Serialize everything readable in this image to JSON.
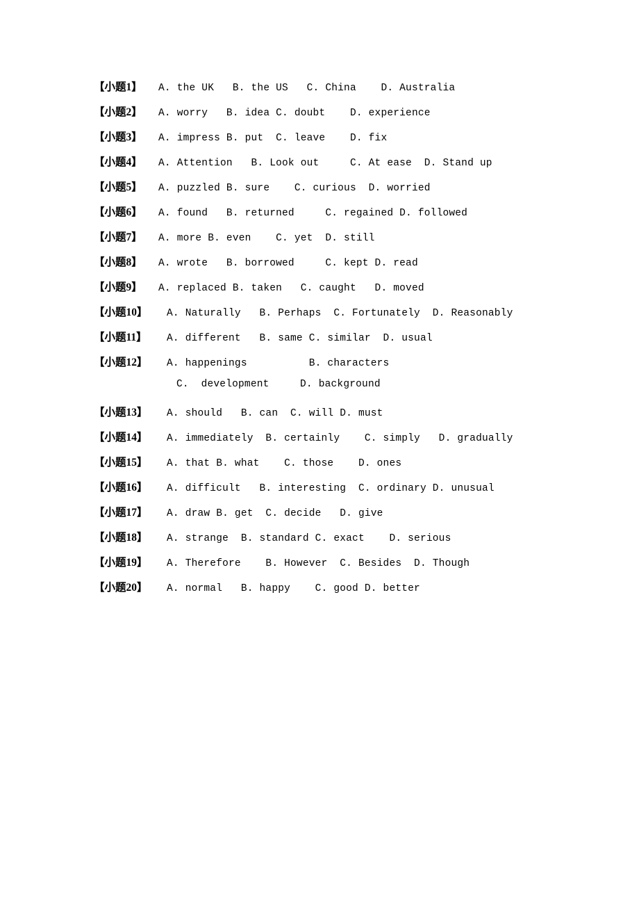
{
  "document": {
    "type": "exam-answer-options-sheet",
    "background_color": "#ffffff",
    "text_color": "#000000"
  },
  "questions": [
    {
      "label": "【小题1】",
      "options": "A. the UK   B. the US   C. China    D. Australia"
    },
    {
      "label": "【小题2】",
      "options": "A. worry   B. idea C. doubt    D. experience"
    },
    {
      "label": "【小题3】",
      "options": "A. impress B. put  C. leave    D. fix"
    },
    {
      "label": "【小题4】",
      "options": "A. Attention   B. Look out     C. At ease  D. Stand up"
    },
    {
      "label": "【小题5】",
      "options": "A. puzzled B. sure    C. curious  D. worried"
    },
    {
      "label": "【小题6】",
      "options": "A. found   B. returned     C. regained D. followed"
    },
    {
      "label": "【小题7】",
      "options": "A. more B. even    C. yet  D. still"
    },
    {
      "label": "【小题8】",
      "options": "A. wrote   B. borrowed     C. kept D. read"
    },
    {
      "label": "【小题9】",
      "options": "A. replaced B. taken   C. caught   D. moved"
    },
    {
      "label": "【小题10】",
      "options": "A. Naturally   B. Perhaps  C. Fortunately  D. Reasonably"
    },
    {
      "label": "【小题11】",
      "options": "A. different   B. same C. similar  D. usual"
    },
    {
      "label": "【小题12】",
      "options": "A. happenings          B. characters"
    },
    {
      "label": "",
      "options": "C.  development     D. background",
      "continuation": true
    },
    {
      "label": "【小题13】",
      "options": "A. should   B. can  C. will D. must"
    },
    {
      "label": "【小题14】",
      "options": "A. immediately  B. certainly    C. simply   D. gradually"
    },
    {
      "label": "【小题15】",
      "options": "A. that B. what    C. those    D. ones"
    },
    {
      "label": "【小题16】",
      "options": "A. difficult   B. interesting  C. ordinary D. unusual"
    },
    {
      "label": "【小题17】",
      "options": "A. draw B. get  C. decide   D. give"
    },
    {
      "label": "【小题18】",
      "options": "A. strange  B. standard C. exact    D. serious"
    },
    {
      "label": "【小题19】",
      "options": "A. Therefore    B. However  C. Besides  D. Though"
    },
    {
      "label": "【小题20】",
      "options": "A. normal   B. happy    C. good D. better"
    }
  ]
}
